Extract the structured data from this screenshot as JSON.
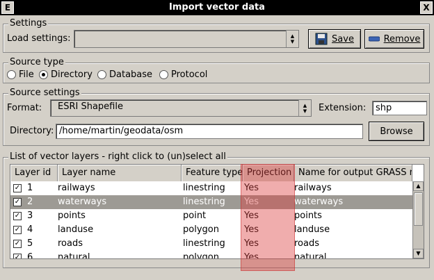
{
  "window": {
    "title": "Import vector data",
    "left_button": "E",
    "right_button": "X"
  },
  "settings": {
    "group_label": "Settings",
    "load_label": "Load settings:",
    "load_value": "",
    "save_label": "Save",
    "remove_label": "Remove"
  },
  "source_type": {
    "group_label": "Source type",
    "options": [
      "File",
      "Directory",
      "Database",
      "Protocol"
    ],
    "selected": "Directory"
  },
  "source_settings": {
    "group_label": "Source settings",
    "format_label": "Format:",
    "format_value": "ESRI Shapefile",
    "extension_label": "Extension:",
    "extension_value": "shp",
    "directory_label": "Directory:",
    "directory_value": "/home/martin/geodata/osm",
    "browse_label": "Browse"
  },
  "layers": {
    "group_label": "List of vector layers - right click to (un)select all",
    "columns": [
      "Layer id",
      "Layer name",
      "Feature type",
      "Projection",
      "Name for output GRASS map"
    ],
    "rows": [
      {
        "id": "1",
        "name": "railways",
        "type": "linestring",
        "projection": "Yes",
        "output": "railways",
        "checked": true,
        "selected": false
      },
      {
        "id": "2",
        "name": "waterways",
        "type": "linestring",
        "projection": "Yes",
        "output": "waterways",
        "checked": true,
        "selected": true
      },
      {
        "id": "3",
        "name": "points",
        "type": "point",
        "projection": "Yes",
        "output": "points",
        "checked": true,
        "selected": false
      },
      {
        "id": "4",
        "name": "landuse",
        "type": "polygon",
        "projection": "Yes",
        "output": "landuse",
        "checked": true,
        "selected": false
      },
      {
        "id": "5",
        "name": "roads",
        "type": "linestring",
        "projection": "Yes",
        "output": "roads",
        "checked": true,
        "selected": false
      },
      {
        "id": "6",
        "name": "natural",
        "type": "polygon",
        "projection": "Yes",
        "output": "natural",
        "checked": true,
        "selected": false
      }
    ]
  },
  "colors": {
    "highlight": "#dc3c3c",
    "selected_row": "#9d9a94",
    "window_bg": "#d4d0c8"
  }
}
